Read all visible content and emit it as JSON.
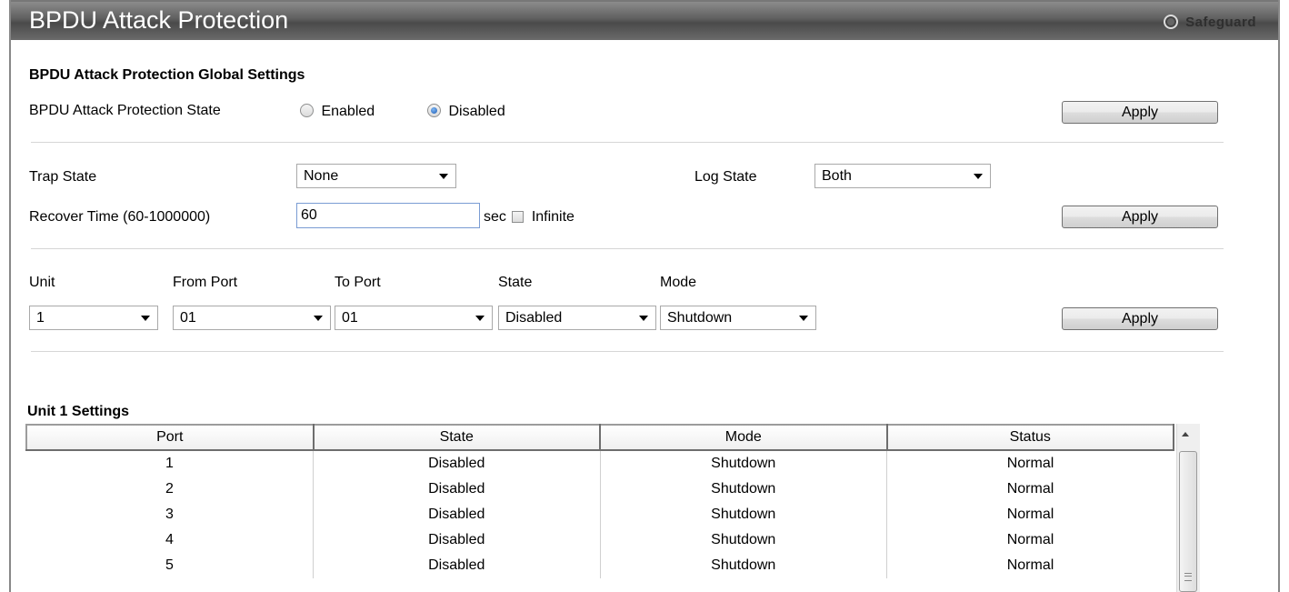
{
  "header": {
    "title": "BPDU Attack Protection",
    "safeguard_label": "Safeguard"
  },
  "global": {
    "section_title": "BPDU Attack Protection Global Settings",
    "state_label": "BPDU Attack Protection State",
    "enabled_label": "Enabled",
    "disabled_label": "Disabled",
    "selected": "Disabled",
    "apply_label": "Apply"
  },
  "trap_log": {
    "trap_label": "Trap State",
    "trap_value": "None",
    "log_label": "Log State",
    "log_value": "Both",
    "recover_label": "Recover Time (60-1000000)",
    "recover_value": "60",
    "sec_label": "sec",
    "infinite_label": "Infinite",
    "infinite_checked": false,
    "apply_label": "Apply"
  },
  "port_settings": {
    "unit_label": "Unit",
    "unit_value": "1",
    "from_label": "From Port",
    "from_value": "01",
    "to_label": "To Port",
    "to_value": "01",
    "state_label": "State",
    "state_value": "Disabled",
    "mode_label": "Mode",
    "mode_value": "Shutdown",
    "apply_label": "Apply"
  },
  "table": {
    "title": "Unit 1 Settings",
    "columns": [
      "Port",
      "State",
      "Mode",
      "Status"
    ],
    "rows": [
      [
        "1",
        "Disabled",
        "Shutdown",
        "Normal"
      ],
      [
        "2",
        "Disabled",
        "Shutdown",
        "Normal"
      ],
      [
        "3",
        "Disabled",
        "Shutdown",
        "Normal"
      ],
      [
        "4",
        "Disabled",
        "Shutdown",
        "Normal"
      ],
      [
        "5",
        "Disabled",
        "Shutdown",
        "Normal"
      ]
    ]
  }
}
